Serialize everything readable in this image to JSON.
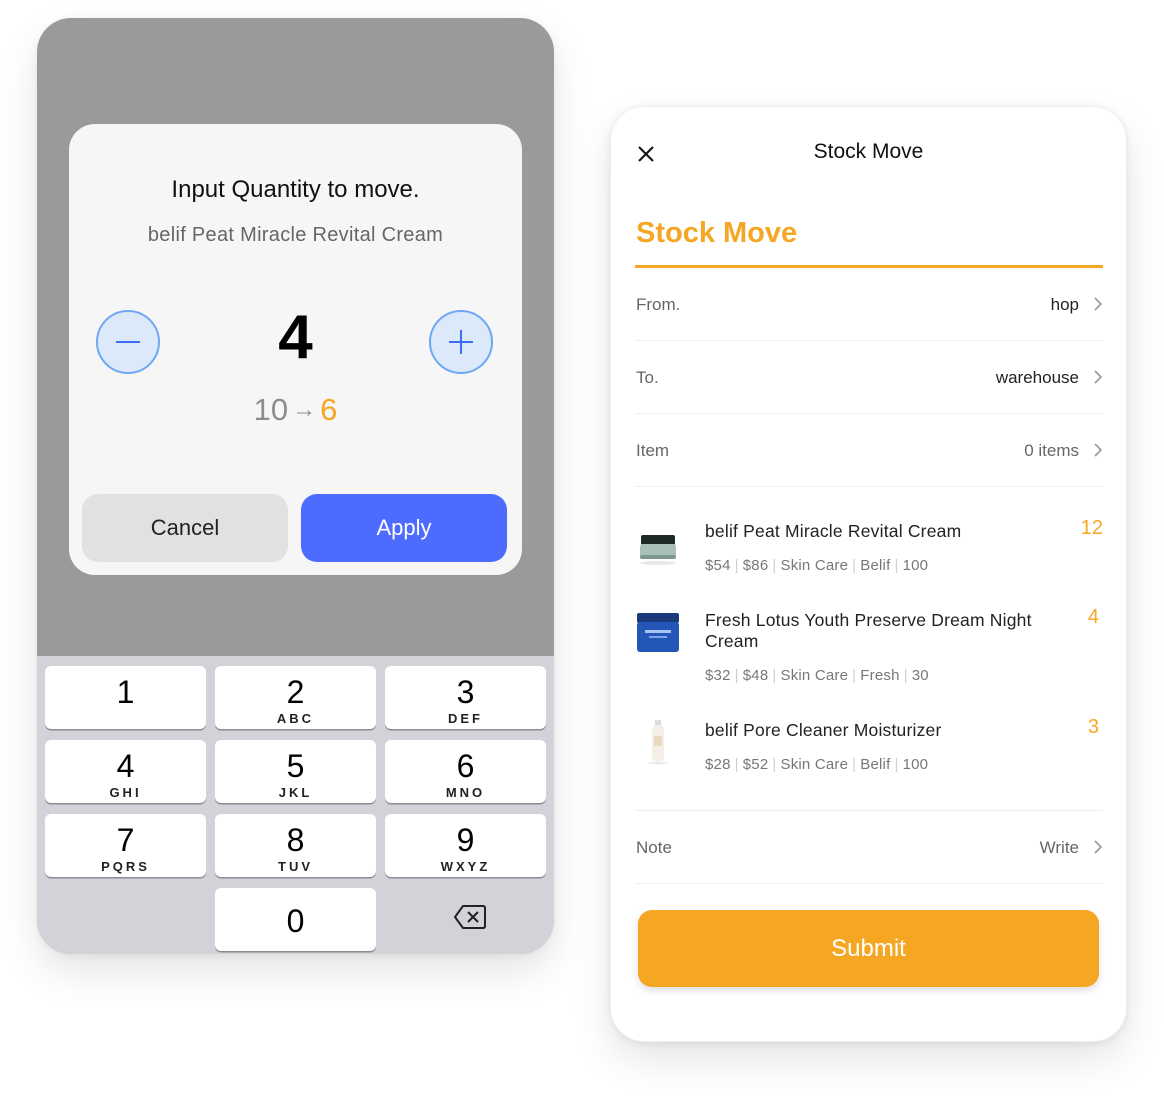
{
  "quantity_dialog": {
    "title": "Input Quantity to move.",
    "product_name": "belif Peat Miracle Revital Cream",
    "quantity": "4",
    "stock_from": "10",
    "arrow": "→",
    "stock_to": "6",
    "cancel_label": "Cancel",
    "apply_label": "Apply"
  },
  "keypad": {
    "keys": [
      {
        "num": "1",
        "letters": ""
      },
      {
        "num": "2",
        "letters": "ABC"
      },
      {
        "num": "3",
        "letters": "DEF"
      },
      {
        "num": "4",
        "letters": "GHI"
      },
      {
        "num": "5",
        "letters": "JKL"
      },
      {
        "num": "6",
        "letters": "MNO"
      },
      {
        "num": "7",
        "letters": "PQRS"
      },
      {
        "num": "8",
        "letters": "TUV"
      },
      {
        "num": "9",
        "letters": "WXYZ"
      },
      {
        "num": "0",
        "letters": ""
      }
    ],
    "delete_icon": "backspace-icon"
  },
  "stock_move": {
    "nav_title": "Stock Move",
    "heading": "Stock Move",
    "from": {
      "label": "From.",
      "value": "hop"
    },
    "to": {
      "label": "To.",
      "value": "warehouse"
    },
    "item": {
      "label": "Item",
      "value": "0 items"
    },
    "items": [
      {
        "name": "belif Peat Miracle Revital Cream",
        "meta": [
          "$54",
          "$86",
          "Skin Care",
          "Belif",
          "100"
        ],
        "qty": "12"
      },
      {
        "name": "Fresh Lotus Youth Preserve Dream Night Cream",
        "meta": [
          "$32",
          "$48",
          "Skin Care",
          "Fresh",
          "30"
        ],
        "qty": "4"
      },
      {
        "name": "belif Pore Cleaner Moisturizer",
        "meta": [
          "$28",
          "$52",
          "Skin Care",
          "Belif",
          "100"
        ],
        "qty": "3"
      }
    ],
    "note": {
      "label": "Note",
      "value": "Write"
    },
    "submit_label": "Submit"
  },
  "colors": {
    "accent": "#f5a623",
    "primary_button": "#4d6bff",
    "stepper_border": "#6ea8f2"
  }
}
